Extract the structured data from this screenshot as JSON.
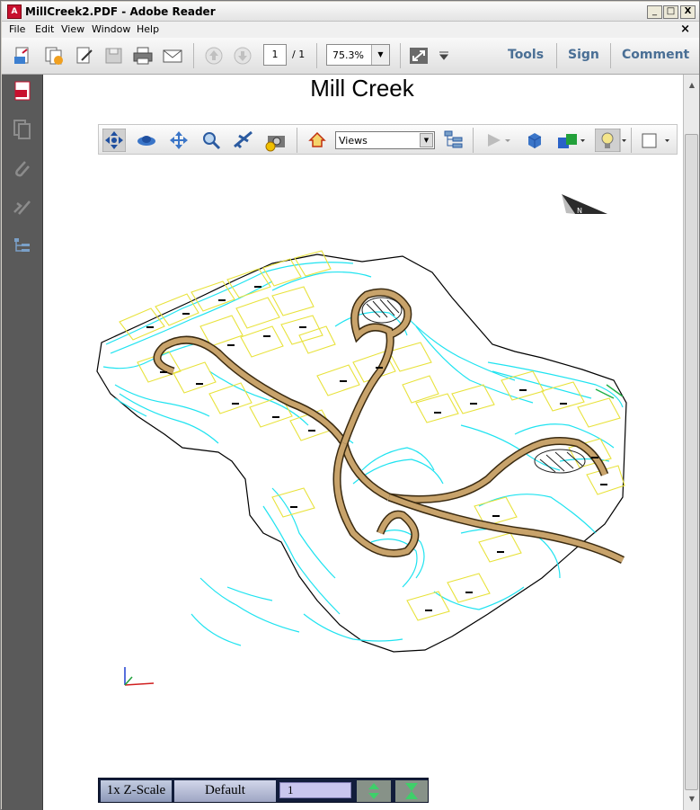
{
  "window": {
    "title": "MillCreek2.PDF - Adobe Reader",
    "app_icon": "pdf-app-icon",
    "controls": {
      "minimize": "_",
      "maximize": "□",
      "close": "X"
    }
  },
  "menu": {
    "items": [
      "File",
      "Edit",
      "View",
      "Window",
      "Help"
    ],
    "close_doc": "×"
  },
  "toolbar": {
    "page_current": "1",
    "page_separator": "/",
    "page_total": "1",
    "zoom": "75.3%",
    "links": [
      "Tools",
      "Sign",
      "Comment"
    ]
  },
  "left_panel": {
    "icons": [
      "pdf-page-icon",
      "pages-icon",
      "attachment-icon",
      "signature-icon",
      "model-tree-icon"
    ]
  },
  "document": {
    "title": "Mill  Creek"
  },
  "toolbar_3d": {
    "views_label": "Views",
    "icons": [
      "rotate-icon",
      "spin-icon",
      "pan-icon",
      "zoom-icon",
      "fly-icon",
      "camera-icon",
      "home-icon",
      "model-tree-toggle-icon",
      "play-icon",
      "render-mode-icon",
      "lighting-icon",
      "background-color-icon"
    ]
  },
  "bottom_bar": {
    "zscale": "1x Z-Scale",
    "preset": "Default",
    "value": "1"
  },
  "colors": {
    "contour": "#1fe3f0",
    "lot": "#e8e23a",
    "road": "#c8a36b",
    "link": "#4a6f95",
    "panel": "#5a5a5a"
  }
}
